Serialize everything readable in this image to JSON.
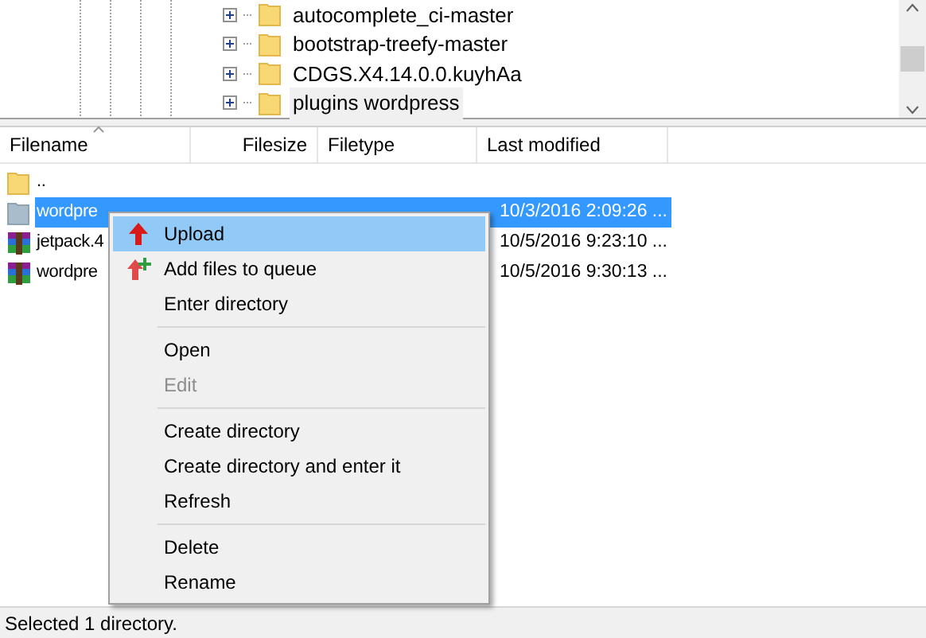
{
  "tree": {
    "items": [
      {
        "label": "autocomplete_ci-master",
        "expanded": false
      },
      {
        "label": "bootstrap-treefy-master",
        "expanded": false
      },
      {
        "label": "CDGS.X4.14.0.0.kuyhAa",
        "expanded": false
      },
      {
        "label": "plugins wordpress",
        "expanded": false,
        "selected": true
      }
    ]
  },
  "file_list": {
    "columns": [
      "Filename",
      "Filesize",
      "Filetype",
      "Last modified"
    ],
    "rows": [
      {
        "kind": "folder",
        "name": "..",
        "modified": "",
        "selected": false
      },
      {
        "kind": "folder",
        "name": "wordpre",
        "modified": "10/3/2016 2:09:26 ...",
        "selected": true
      },
      {
        "kind": "archive",
        "name": "jetpack.4",
        "modified": "10/5/2016 9:23:10 ...",
        "selected": false
      },
      {
        "kind": "archive",
        "name": "wordpre",
        "modified": "10/5/2016 9:30:13 ...",
        "selected": false
      }
    ]
  },
  "context_menu": {
    "items": [
      {
        "kind": "upload",
        "label": "Upload",
        "highlighted": true,
        "disabled": false
      },
      {
        "kind": "queue",
        "label": "Add files to queue",
        "highlighted": false,
        "disabled": false
      },
      {
        "kind": "item",
        "label": "Enter directory",
        "highlighted": false,
        "disabled": false
      },
      {
        "kind": "separator"
      },
      {
        "kind": "item",
        "label": "Open",
        "highlighted": false,
        "disabled": false
      },
      {
        "kind": "item",
        "label": "Edit",
        "highlighted": false,
        "disabled": true
      },
      {
        "kind": "separator"
      },
      {
        "kind": "item",
        "label": "Create directory",
        "highlighted": false,
        "disabled": false
      },
      {
        "kind": "item",
        "label": "Create directory and enter it",
        "highlighted": false,
        "disabled": false
      },
      {
        "kind": "item",
        "label": "Refresh",
        "highlighted": false,
        "disabled": false
      },
      {
        "kind": "separator"
      },
      {
        "kind": "item",
        "label": "Delete",
        "highlighted": false,
        "disabled": false
      },
      {
        "kind": "item",
        "label": "Rename",
        "highlighted": false,
        "disabled": false
      }
    ]
  },
  "status_bar": "Selected 1 directory."
}
